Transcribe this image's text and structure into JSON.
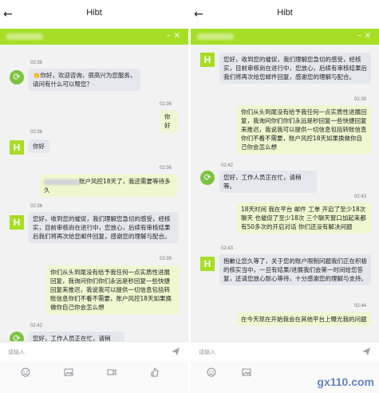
{
  "app_title": "Hibt",
  "input_placeholder": "请输入",
  "watermark": "gx110.com",
  "colors": {
    "accent_green": "#a6de26",
    "agent_bubble": "#e4e7ee",
    "user_bubble": "#eef7cf"
  },
  "left": {
    "t1": "02:36",
    "m1": "👏你好，欢迎咨询，很高兴为您服务，请问有什么可以帮您？",
    "t2": "02:36",
    "m2": "你好",
    "t3": "02:36",
    "m3": "你好",
    "t4": "02:36",
    "m4": "账户风控18天了，我还需要等待多久",
    "t5": "02:36",
    "m5": "您好，收到您的催促，我们理解您急切的感受，经核实，目前审核尚在进行中，您放心，后续有审核结果后我们将再次给您邮件回复，感谢您的理解与配合。",
    "t6": "02:39",
    "m6": "你们从头到尾没有给予我任何一点实质性进展回复，我询问你们你们永远是秒回复一些快捷回复来推迟，我说我可以提供一切信息包括转账信息你们不看不需要，账户风控18天如果换做你自己你会怎么想",
    "t7": "02:42",
    "m7": "您好，工作人员正在忙，请稍等。"
  },
  "right": {
    "m1": "您好，收到您的催促，我们理解您急切的感受，经核实，目前审核尚在进行中，您放心，后续有审核结果后我们将再次给您邮件回复，感谢您的理解与配合。",
    "t2": "02:39",
    "m2": "你们从头到尾没有给予我任何一点实质性进展回复，我询问你们你们永远是秒回复一些快捷回复来推迟，我说我可以提供一切信息包括转账信息你们不看不需要，账户风控18天如果换做你自己你会怎么想",
    "t3": "02:42",
    "m3": "您好，工作人员正在忙，请稍等。",
    "t4": "02:43",
    "m4": "18天时间 我在平台 邮件 工单 开启了至少18次聊天 也催促了至少18次 三个聊天窗口加起来都有50多次的开启对话 你们还没有解决问题",
    "t5": "02:43",
    "m5": "抱歉让您久等了，关于您的账户限制问题我们正在积极的核实当中，一旦有结果/进展我们会第一时间给您答复，还请您放心耐心等待，十分感谢您的理解与支持。",
    "t6": "02:44",
    "m6": "在今天现在开始我会在其他平台上曝光我的问题"
  }
}
